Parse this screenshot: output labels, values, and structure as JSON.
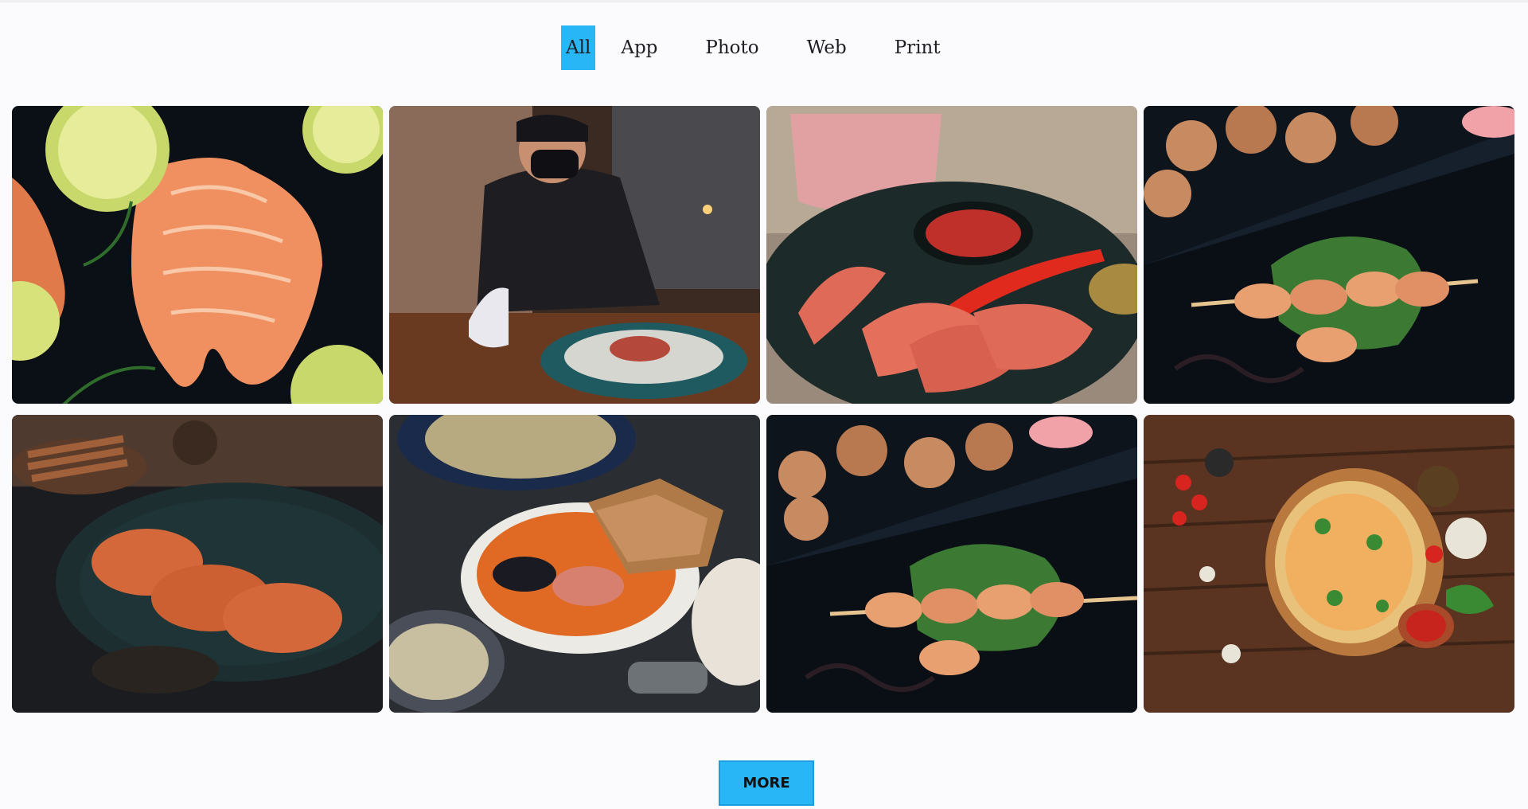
{
  "filters": [
    {
      "label": "All",
      "active": true
    },
    {
      "label": "App",
      "active": false
    },
    {
      "label": "Photo",
      "active": false
    },
    {
      "label": "Web",
      "active": false
    },
    {
      "label": "Print",
      "active": false
    }
  ],
  "gallery": {
    "items": [
      {
        "subject": "salmon-steaks-with-lemon"
      },
      {
        "subject": "chef-serving-dish"
      },
      {
        "subject": "grilled-prawns-with-sauce"
      },
      {
        "subject": "shrimp-skewers-on-slate"
      },
      {
        "subject": "crabs-on-plate"
      },
      {
        "subject": "seafood-soup-with-bread"
      },
      {
        "subject": "shrimp-skewers-on-slate"
      },
      {
        "subject": "pizza-on-wooden-board"
      }
    ]
  },
  "more_button": {
    "label": "MORE"
  },
  "colors": {
    "accent": "#29b6f6",
    "background": "#fbfbfd",
    "text": "#1e1e24"
  }
}
